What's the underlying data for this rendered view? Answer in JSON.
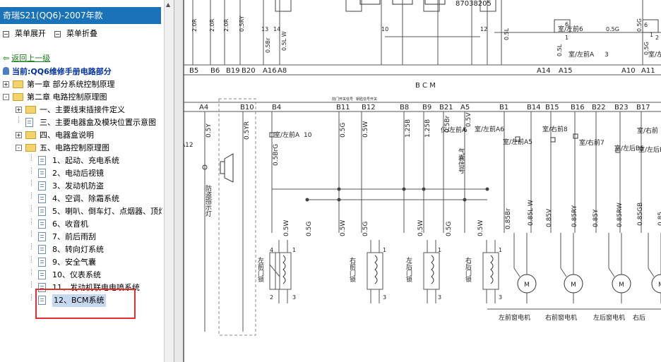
{
  "left": {
    "title": "奇瑞S21(QQ6)-2007年款",
    "expand_all": "菜单展开",
    "collapse_all": "菜单折叠",
    "back_link": "返回上一级",
    "current": "当前:QQ6维修手册电路部分",
    "tree": [
      {
        "label": "第一章 部分系统控制原理",
        "level": 0,
        "type": "folder",
        "toggle": "+"
      },
      {
        "label": "第二章 电路控制原理图",
        "level": 0,
        "type": "folder",
        "toggle": "-"
      },
      {
        "label": "一、主要线束插接件定义",
        "level": 1,
        "type": "folder",
        "toggle": "+"
      },
      {
        "label": "三、主要电器盒及模块位置示意图",
        "level": 1,
        "type": "page",
        "toggle": ""
      },
      {
        "label": "四、电器盒说明",
        "level": 1,
        "type": "folder",
        "toggle": "+"
      },
      {
        "label": "五、电路控制原理图",
        "level": 1,
        "type": "folder",
        "toggle": "-"
      },
      {
        "label": "1、起动、充电系统",
        "level": 2,
        "type": "page",
        "toggle": ""
      },
      {
        "label": "2、电动后视镜",
        "level": 2,
        "type": "page",
        "toggle": ""
      },
      {
        "label": "3、发动机防盗",
        "level": 2,
        "type": "page",
        "toggle": ""
      },
      {
        "label": "4、空调、除霜系统",
        "level": 2,
        "type": "page",
        "toggle": ""
      },
      {
        "label": "5、喇叭、倒车灯、点烟器、顶灯",
        "level": 2,
        "type": "page",
        "toggle": ""
      },
      {
        "label": "6、收音机",
        "level": 2,
        "type": "page",
        "toggle": ""
      },
      {
        "label": "7、前后雨刮",
        "level": 2,
        "type": "page",
        "toggle": ""
      },
      {
        "label": "8、转向灯系统",
        "level": 2,
        "type": "page",
        "toggle": ""
      },
      {
        "label": "9、安全气囊",
        "level": 2,
        "type": "page",
        "toggle": ""
      },
      {
        "label": "10、仪表系统",
        "level": 2,
        "type": "page",
        "toggle": ""
      },
      {
        "label": "11、发动机联电电喷系统",
        "level": 2,
        "type": "page",
        "toggle": ""
      },
      {
        "label": "12、BCM系统",
        "level": 2,
        "type": "page",
        "toggle": "",
        "selected": true
      }
    ]
  },
  "diagram": {
    "top_number": "87038205",
    "top_labels": [
      "2.0R",
      "2.0R",
      "2.0R",
      "0.5RY",
      "0.5Br",
      "0.5L W",
      "0.5L",
      "0.5L",
      "0.5G",
      "0.5G"
    ],
    "top_numbers": [
      "13",
      "14",
      "10",
      "12",
      "6",
      "6",
      "1",
      "1",
      "2"
    ],
    "top_pins": [
      "B5",
      "B6",
      "B19",
      "B20",
      "A16",
      "A8",
      "A14",
      "A15",
      "A10",
      "A11"
    ],
    "top_pin_notes": [
      "室/左前6",
      "0.5G",
      "室/左前A",
      "3",
      "室/左前A"
    ],
    "bcm_label": "B C M",
    "pins": [
      "A4",
      "B10",
      "B4",
      "B11",
      "B12",
      "B8",
      "B9",
      "B21",
      "A5",
      "B1",
      "B14",
      "B15",
      "B16",
      "B22",
      "B23",
      "B17"
    ],
    "pin_small_notes": [
      "前门开关信号",
      "钥匙信号开关"
    ],
    "wire_labels": [
      "0.5Y",
      "0.5YR",
      "0.5BrG",
      "0.5G",
      "0.5W",
      "1.25B",
      "1.25B",
      "0.5Br",
      "0.5V",
      "0.5W",
      "0.5G",
      "0.5W",
      "0.5G",
      "0.5W",
      "0.5G",
      "0.5W",
      "0.85Br",
      "0.85L W",
      "0.85V",
      "0.85RY",
      "0.85Y",
      "0.85RW",
      "0.85GB",
      "0.85"
    ],
    "connector_notes": [
      "A12",
      "室/左前A",
      "10",
      "仪/左前A",
      "6",
      "室/左前A6",
      "室/左前A5",
      "室/右前8",
      "室/右前7",
      "室/左后B5",
      "室/右前",
      "室/左后B"
    ],
    "labels": {
      "anti_theft": "防盗指示灯",
      "airbag": "气囊信号",
      "lf_lock": "左前门锁",
      "rf_lock": "右前门锁",
      "lr_lock": "左后门锁",
      "rr_lock": "右后门锁",
      "lf_motor": "左前窗电机",
      "rf_motor": "右前窗电机",
      "lr_motor": "左后窗电机",
      "rr_motor": "右后"
    },
    "motor_symbol": "M",
    "lock_pins": [
      "4",
      "1",
      "2",
      "3",
      "1",
      "3",
      "1",
      "3",
      "1",
      "3"
    ]
  }
}
